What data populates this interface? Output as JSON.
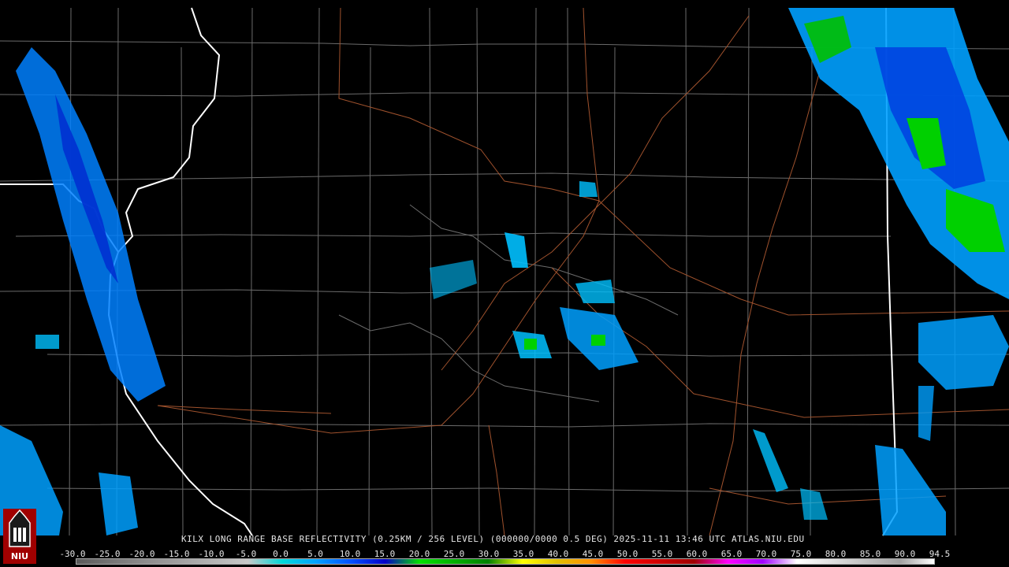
{
  "radar": {
    "station": "KILX",
    "product_line": "KILX LONG RANGE BASE REFLECTIVITY (0.25KM / 256 LEVEL) (000000/0000 0.5 DEG) 2025-11-11 13:46 UTC  ATLAS.NIU.EDU",
    "logo_text": "NIU"
  },
  "colors": {
    "background": "#000000",
    "county_lines": "#6b6b6b",
    "state_lines": "#ffffff",
    "highways": "#a0522d",
    "text": "#e6e6e6"
  },
  "scale": {
    "labels": [
      "-30.0",
      "-25.0",
      "-20.0",
      "-15.0",
      "-10.0",
      "-5.0",
      "0.0",
      "5.0",
      "10.0",
      "15.0",
      "20.0",
      "25.0",
      "30.0",
      "35.0",
      "40.0",
      "45.0",
      "50.0",
      "55.0",
      "60.0",
      "65.0",
      "70.0",
      "75.0",
      "80.0",
      "85.0",
      "90.0",
      "94.5"
    ],
    "colors": [
      "#5a5a5a",
      "#747474",
      "#8c8c8c",
      "#a0a0a0",
      "#b4b4b4",
      "#c8c8c8",
      "#00d8d8",
      "#00a0ff",
      "#0050ff",
      "#0000c8",
      "#00e000",
      "#00b000",
      "#008000",
      "#ffff00",
      "#e0c000",
      "#ff9000",
      "#ff0000",
      "#d00000",
      "#a00000",
      "#ff00ff",
      "#a000ff",
      "#ffffff",
      "#e0e0e0",
      "#c0c0c0",
      "#a0a0a0",
      "#ffffff"
    ]
  }
}
